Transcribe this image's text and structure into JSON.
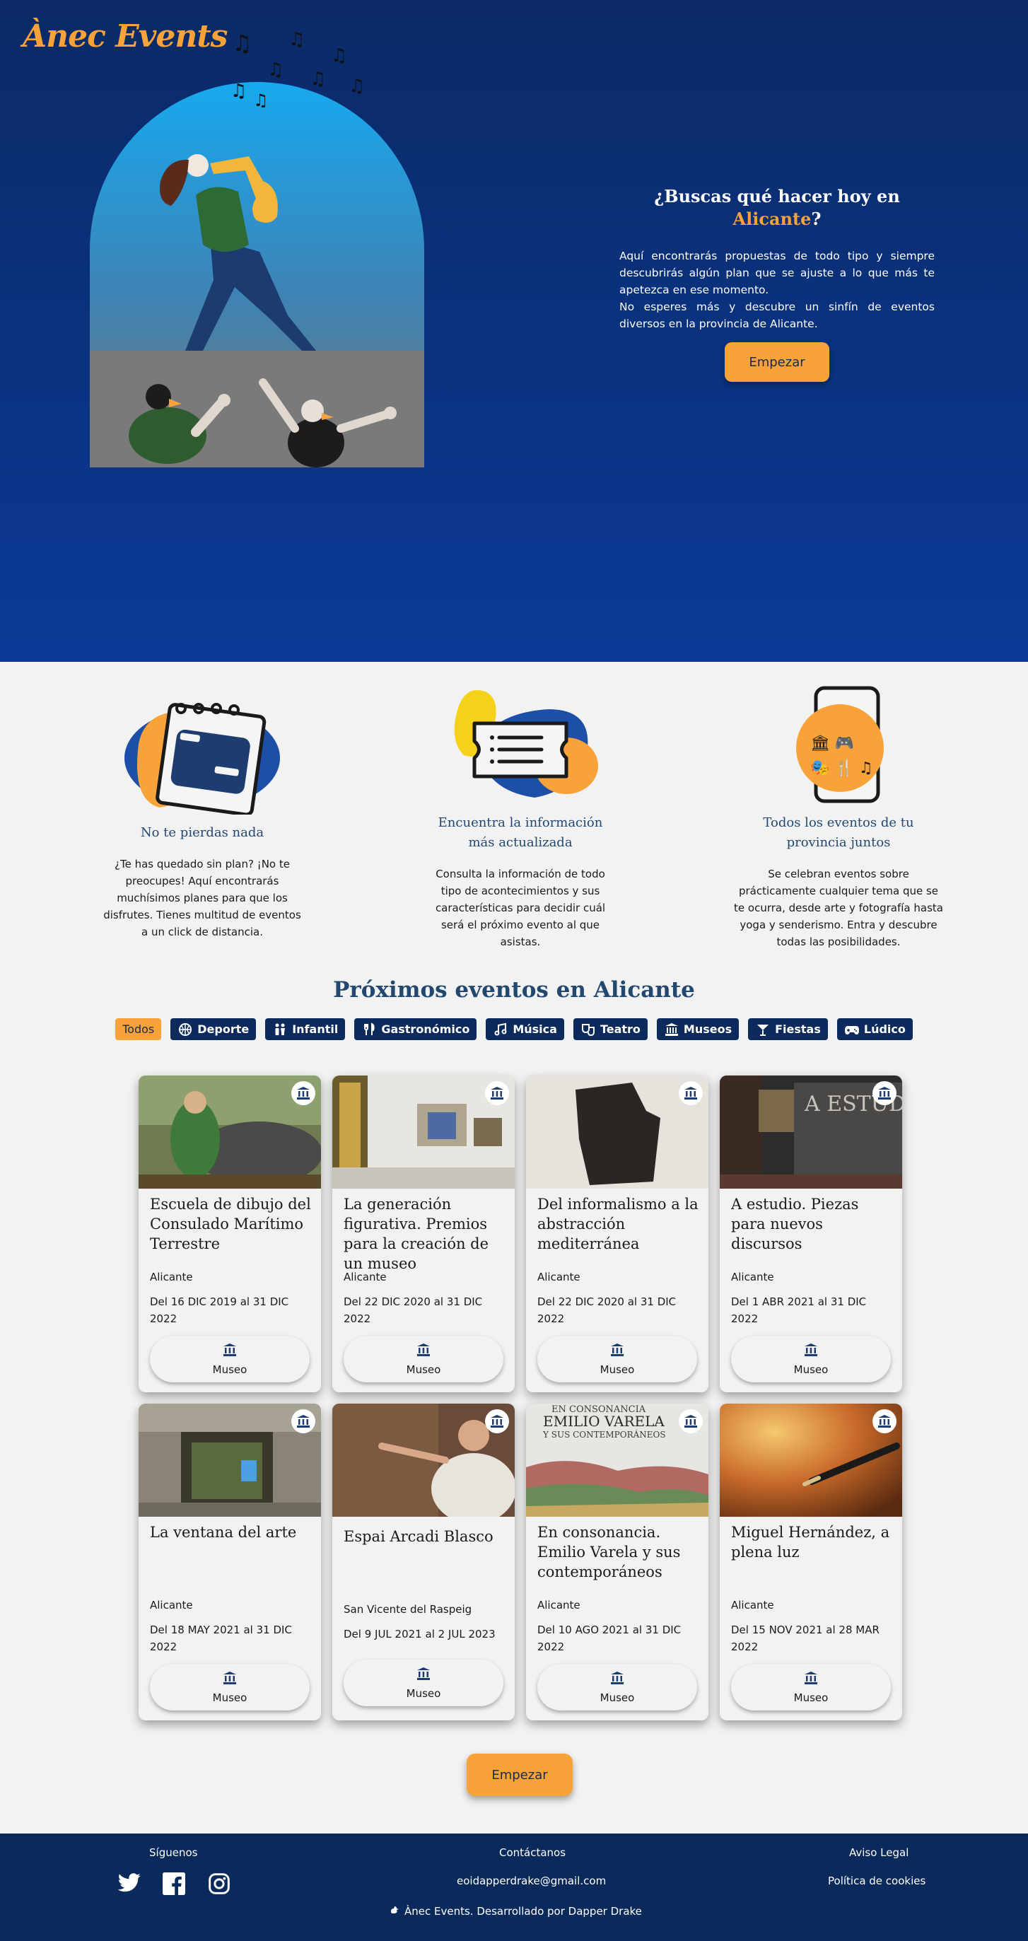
{
  "brand": {
    "name": "Ànec Events"
  },
  "hero": {
    "title_part1": "¿Buscas qué hacer hoy en",
    "title_city": "Alicante",
    "title_end": "?",
    "description": "Aquí encontrarás propuestas de todo tipo y siempre descubrirás algún plan que se ajuste a lo que más te apetezca en ese momento.",
    "description2": "No esperes más y descubre un sinfín de eventos diversos en la provincia de Alicante.",
    "cta_label": "Empezar"
  },
  "features": [
    {
      "icon": "calendar-icon",
      "title": "No te pierdas nada",
      "description": "¿Te has quedado sin plan? ¡No te preocupes! Aquí encontrarás muchísimos planes para que los disfrutes. Tienes multitud de eventos a un click de distancia."
    },
    {
      "icon": "ticket-icon",
      "title": "Encuentra la información más actualizada",
      "description": "Consulta la información de todo tipo de acontecimientos y sus características para decidir cuál será el próximo evento al que asistas."
    },
    {
      "icon": "phone-icon",
      "title": "Todos los eventos de tu provincia juntos",
      "description": "Se celebran eventos sobre prácticamente cualquier tema que se te ocurra, desde arte y fotografía hasta yoga y senderismo. Entra y descubre todas las posibilidades."
    }
  ],
  "events_section": {
    "title": "Próximos eventos en Alicante"
  },
  "filters": [
    {
      "label": "Todos",
      "icon": "",
      "active": true
    },
    {
      "label": "Deporte",
      "icon": "basketball-icon"
    },
    {
      "label": "Infantil",
      "icon": "children-icon"
    },
    {
      "label": "Gastronómico",
      "icon": "cutlery-icon"
    },
    {
      "label": "Música",
      "icon": "music-note-icon"
    },
    {
      "label": "Teatro",
      "icon": "theater-masks-icon"
    },
    {
      "label": "Museos",
      "icon": "museum-icon"
    },
    {
      "label": "Fiestas",
      "icon": "cocktail-icon"
    },
    {
      "label": "Lúdico",
      "icon": "gamepad-icon"
    }
  ],
  "events": [
    {
      "title": "Escuela de dibujo del Consulado Marítimo Terrestre",
      "city": "Alicante",
      "dates": "Del 16 DIC 2019 al 31 DIC 2022",
      "category": "Museo"
    },
    {
      "title": "La generación figurativa. Premios para la creación de un museo",
      "city": "Alicante",
      "dates": "Del 22 DIC 2020 al 31 DIC 2022",
      "category": "Museo"
    },
    {
      "title": "Del informalismo a la abstracción mediterránea",
      "city": "Alicante",
      "dates": "Del 22 DIC 2020 al 31 DIC 2022",
      "category": "Museo"
    },
    {
      "title": "A estudio. Piezas para nuevos discursos",
      "city": "Alicante",
      "dates": "Del 1 ABR 2021 al 31 DIC 2022",
      "category": "Museo"
    },
    {
      "title": "La ventana del arte",
      "city": "Alicante",
      "dates": "Del 18 MAY 2021 al 31 DIC 2022",
      "category": "Museo"
    },
    {
      "title": "Espai Arcadi Blasco",
      "city": "San Vicente del Raspeig",
      "dates": "Del 9 JUL 2021 al 2 JUL 2023",
      "category": "Museo"
    },
    {
      "title": "En consonancia. Emilio Varela y sus contemporáneos",
      "city": "Alicante",
      "dates": "Del 10 AGO 2021 al 31 DIC 2022",
      "category": "Museo"
    },
    {
      "title": "Miguel Hernández, a plena luz",
      "city": "Alicante",
      "dates": "Del 15 NOV 2021 al 28 MAR 2022",
      "category": "Museo"
    }
  ],
  "poster_texts": {
    "en_consonancia_1": "EN CONSONANCIA",
    "en_consonancia_2": "EMILIO VARELA",
    "en_consonancia_3": "Y SUS CONTEMPORÁNEOS",
    "a_estudio": "A ESTUD"
  },
  "bottom_cta": {
    "label": "Empezar"
  },
  "footer": {
    "follow_label": "Síguenos",
    "contact_label": "Contáctanos",
    "email": "eoidapperdrake@gmail.com",
    "legal_label": "Aviso Legal",
    "cookies_label": "Política de cookies",
    "credit": "Ànec Events. Desarrollado por Dapper Drake"
  },
  "colors": {
    "accent": "#f7a33a",
    "navy": "#0b2a5c",
    "title_blue": "#23486f"
  }
}
